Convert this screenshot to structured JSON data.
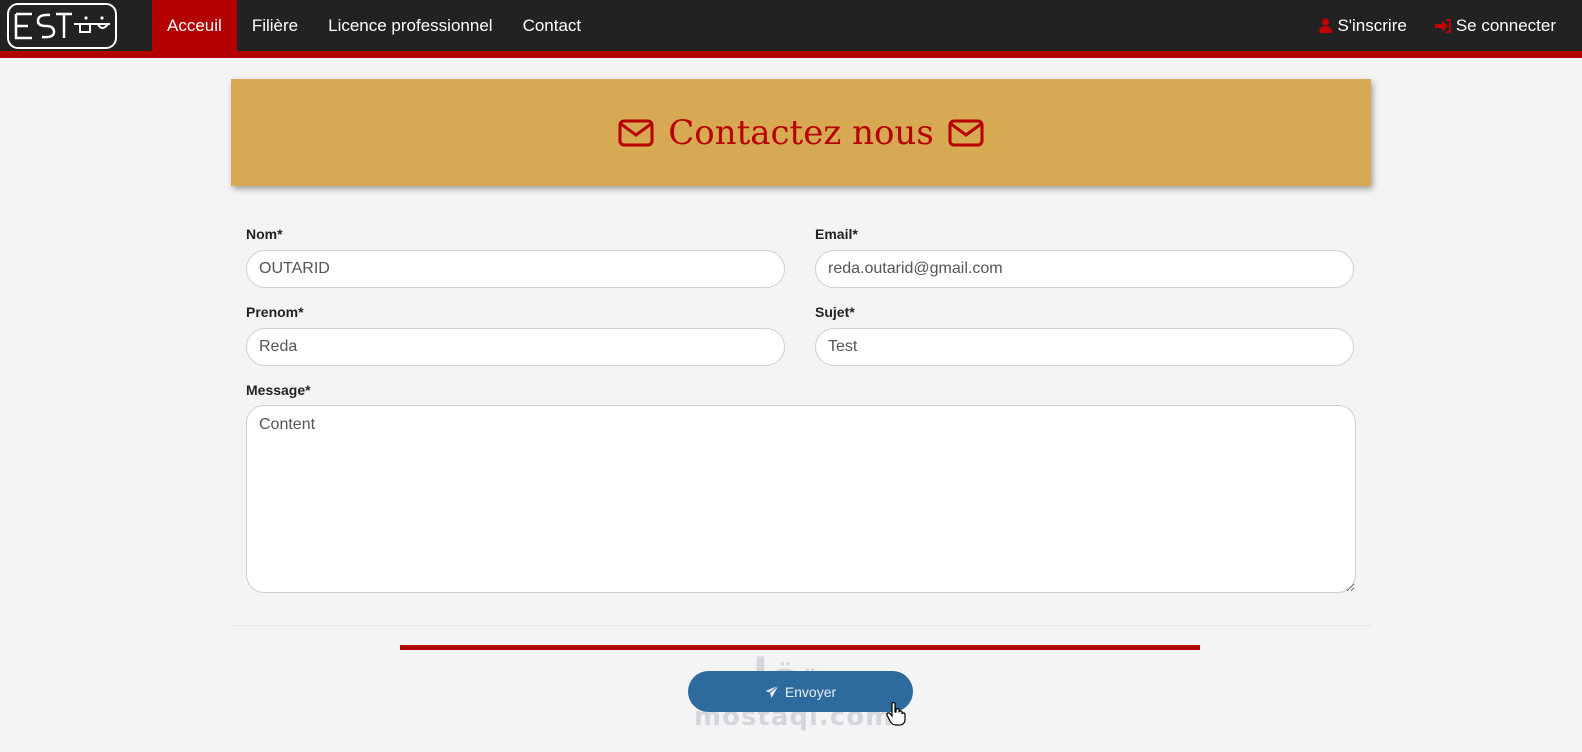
{
  "nav": {
    "brand_name": "EST",
    "items": [
      {
        "label": "Acceuil",
        "active": true
      },
      {
        "label": "Filière",
        "active": false
      },
      {
        "label": "Licence professionnel",
        "active": false
      },
      {
        "label": "Contact",
        "active": false
      }
    ],
    "register_label": "S'inscrire",
    "login_label": "Se connecter"
  },
  "header": {
    "title": "Contactez nous"
  },
  "form": {
    "nom_label": "Nom*",
    "nom_value": "OUTARID",
    "email_label": "Email*",
    "email_value": "reda.outarid@gmail.com",
    "prenom_label": "Prenom*",
    "prenom_value": "Reda",
    "sujet_label": "Sujet*",
    "sujet_value": "Test",
    "message_label": "Message*",
    "message_value": "Content",
    "submit_label": "Envoyer"
  },
  "watermark": {
    "arabic": "مستقل",
    "latin": "mostaqi.com"
  },
  "colors": {
    "navbar": "#222222",
    "accent_red": "#b30000",
    "hero_gold": "#d6a952",
    "button_blue": "#2d6a9e"
  },
  "icons": {
    "register": "user-icon",
    "login": "sign-in-icon",
    "header": "envelope-icon",
    "submit": "paper-plane-icon"
  }
}
